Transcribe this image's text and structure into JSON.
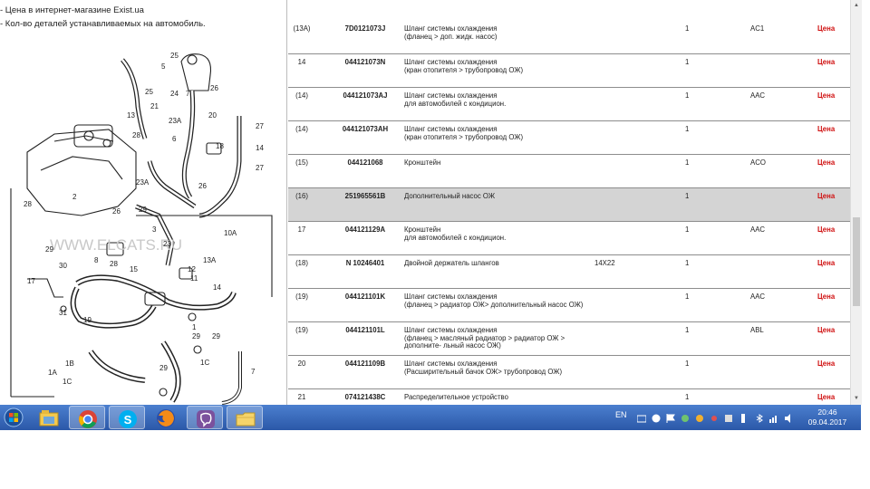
{
  "notes": {
    "price_note": "- Цена в интернет-магазине Exist.ua",
    "qty_note": "- Кол-во деталей устанавливаемых на автомобиль."
  },
  "diagram": {
    "watermark": "WWW.ELCATS.RU",
    "callouts": [
      "25",
      "5",
      "26",
      "25",
      "24",
      "7",
      "21",
      "23A",
      "13",
      "20",
      "27",
      "28",
      "6",
      "18",
      "14",
      "27",
      "23A",
      "26",
      "2",
      "28",
      "26",
      "29",
      "3",
      "23",
      "10A",
      "13A",
      "29",
      "8",
      "28",
      "15",
      "12",
      "11",
      "30",
      "17",
      "31",
      "14",
      "19",
      "1",
      "29",
      "29",
      "1B",
      "1A",
      "1C",
      "29",
      "1C",
      "7"
    ]
  },
  "table": {
    "rows": [
      {
        "pos": "(13А)",
        "num": "7D0121073J",
        "desc": [
          "Шланг системы охлаждения",
          "(фланец > доп. жидк. насос)"
        ],
        "dim": "",
        "qty": "1",
        "code": "AC1",
        "price": "Цена",
        "highlight": false
      },
      {
        "pos": "14",
        "num": "044121073N",
        "desc": [
          "Шланг системы охлаждения",
          "(кран отопителя > трубопровод ОЖ)"
        ],
        "dim": "",
        "qty": "1",
        "code": "",
        "price": "Цена",
        "highlight": false
      },
      {
        "pos": "(14)",
        "num": "044121073AJ",
        "desc": [
          "Шланг системы охлаждения",
          "для автомобилей с кондицион."
        ],
        "dim": "",
        "qty": "1",
        "code": "AAC",
        "price": "Цена",
        "highlight": false
      },
      {
        "pos": "(14)",
        "num": "044121073AH",
        "desc": [
          "Шланг системы охлаждения",
          "(кран отопителя > трубопровод ОЖ)"
        ],
        "dim": "",
        "qty": "1",
        "code": "",
        "price": "Цена",
        "highlight": false
      },
      {
        "pos": "(15)",
        "num": "044121068",
        "desc": [
          "Кронштейн"
        ],
        "dim": "",
        "qty": "1",
        "code": "ACO",
        "price": "Цена",
        "highlight": false
      },
      {
        "pos": "(16)",
        "num": "251965561B",
        "desc": [
          "Дополнительный насос ОЖ"
        ],
        "dim": "",
        "qty": "1",
        "code": "",
        "price": "Цена",
        "highlight": true
      },
      {
        "pos": "17",
        "num": "044121129A",
        "desc": [
          "Кронштейн",
          "для автомобилей с кондицион."
        ],
        "dim": "",
        "qty": "1",
        "code": "AAC",
        "price": "Цена",
        "highlight": false
      },
      {
        "pos": "(18)",
        "num": "N 10246401",
        "desc": [
          "Двойной держатель шлангов"
        ],
        "dim": "14X22",
        "qty": "1",
        "code": "",
        "price": "Цена",
        "highlight": false
      },
      {
        "pos": "(19)",
        "num": "044121101K",
        "desc": [
          "Шланг системы охлаждения",
          "(фланец > радиатор ОЖ> дополнительный насос ОЖ)"
        ],
        "dim": "",
        "qty": "1",
        "code": "AAC",
        "price": "Цена",
        "highlight": false
      },
      {
        "pos": "(19)",
        "num": "044121101L",
        "desc": [
          "Шланг системы охлаждения",
          "(фланец > масляный радиатор > радиатор ОЖ >",
          "дополните- льный насос ОЖ)"
        ],
        "dim": "",
        "qty": "1",
        "code": "ABL",
        "price": "Цена",
        "highlight": false
      },
      {
        "pos": "20",
        "num": "044121109B",
        "desc": [
          "Шланг системы охлаждения",
          "(Расширительный бачок ОЖ> трубопровод ОЖ)"
        ],
        "dim": "",
        "qty": "1",
        "code": "",
        "price": "Цена",
        "highlight": false
      },
      {
        "pos": "21",
        "num": "074121438C",
        "desc": [
          "Распределительное устройство"
        ],
        "dim": "",
        "qty": "1",
        "code": "",
        "price": "Цена",
        "highlight": false
      }
    ]
  },
  "taskbar": {
    "apps": [
      "start-button",
      "file-explorer",
      "chrome",
      "skype",
      "firefox",
      "viber",
      "folder"
    ],
    "lang": "EN",
    "time": "20:46",
    "date": "09.04.2017"
  },
  "colors": {
    "price": "#d01010",
    "taskbar": "#2b58a8",
    "highlight_row": "#d4d4d4"
  }
}
